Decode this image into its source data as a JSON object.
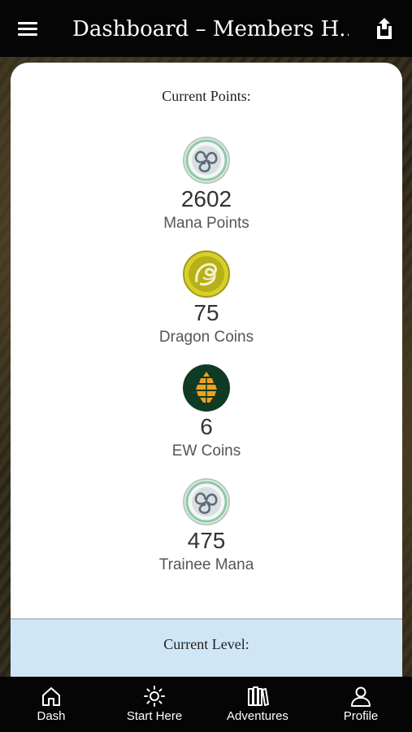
{
  "header": {
    "title": "Dashboard – Members H...",
    "menu_icon": "hamburger-menu-icon",
    "share_icon": "share-icon"
  },
  "points": {
    "heading": "Current Points:",
    "items": [
      {
        "value": "2602",
        "label": "Mana Points",
        "icon": "triskele-coin-icon"
      },
      {
        "value": "75",
        "label": "Dragon Coins",
        "icon": "dragon-coin-icon"
      },
      {
        "value": "6",
        "label": "EW Coins",
        "icon": "pine-cone-coin-icon"
      },
      {
        "value": "475",
        "label": "Trainee Mana",
        "icon": "triskele-coin-icon"
      }
    ]
  },
  "level": {
    "heading": "Current Level:"
  },
  "nav": {
    "items": [
      {
        "label": "Dash",
        "icon": "home-icon"
      },
      {
        "label": "Start Here",
        "icon": "sun-icon"
      },
      {
        "label": "Adventures",
        "icon": "books-icon"
      },
      {
        "label": "Profile",
        "icon": "person-icon"
      }
    ]
  },
  "colors": {
    "bar_background": "#050505",
    "level_background": "#cfe6f7",
    "dragon_coin": "#c8c020",
    "ew_coin_bg": "#0f3a24",
    "ew_coin_fg": "#f0a020",
    "mana_coin": "#9fd3b4"
  }
}
